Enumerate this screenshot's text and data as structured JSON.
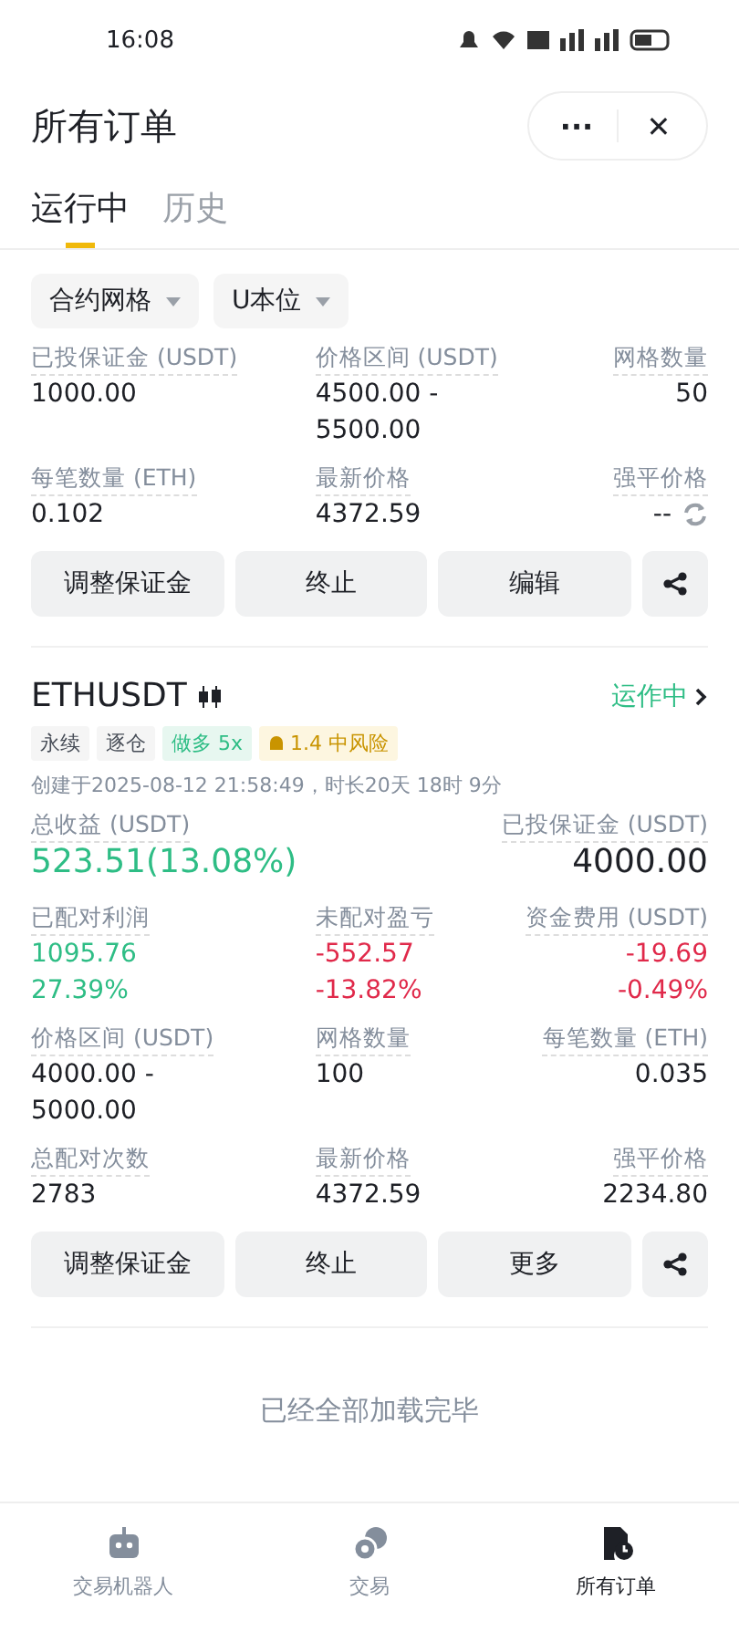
{
  "status_bar": {
    "time": "16:08"
  },
  "header": {
    "title": "所有订单",
    "more": "···",
    "close": "✕"
  },
  "tabs": [
    {
      "label": "运行中",
      "selected": true
    },
    {
      "label": "历史",
      "selected": false
    }
  ],
  "filters": [
    {
      "label": "合约网格"
    },
    {
      "label": "U本位"
    }
  ],
  "orders": [
    {
      "fields": [
        {
          "label": "已投保证金 (USDT)",
          "values": [
            {
              "text": "1000.00",
              "kind": "plain"
            }
          ]
        },
        {
          "label": "价格区间 (USDT)",
          "values": [
            {
              "text": "4500.00 -",
              "kind": "plain"
            },
            {
              "text": "5500.00",
              "kind": "plain"
            }
          ]
        },
        {
          "label": "网格数量",
          "values": [
            {
              "text": "50",
              "kind": "plain"
            }
          ]
        },
        {
          "label": "每笔数量 (ETH)",
          "values": [
            {
              "text": "0.102",
              "kind": "plain"
            }
          ]
        },
        {
          "label": "最新价格",
          "values": [
            {
              "text": "4372.59",
              "kind": "plain"
            }
          ]
        },
        {
          "label": "强平价格",
          "values": [
            {
              "text": "--",
              "kind": "plain",
              "refresh": true
            }
          ]
        }
      ],
      "actions": [
        "调整保证金",
        "终止",
        "编辑"
      ]
    },
    {
      "symbol": "ETHUSDT",
      "status": "运作中",
      "tags": [
        {
          "label": "永续",
          "kind": "plain"
        },
        {
          "label": "逐仓",
          "kind": "plain"
        },
        {
          "label": "做多 5x",
          "kind": "long"
        },
        {
          "label": "1.4 中风险",
          "kind": "risk"
        }
      ],
      "created": "创建于2025-08-12 21:58:49，时长20天 18时 9分",
      "summary": [
        {
          "label": "总收益 (USDT)",
          "value": "523.51(13.08%)",
          "kind": "green"
        },
        {
          "label": "已投保证金 (USDT)",
          "value": "4000.00",
          "kind": "plain"
        }
      ],
      "fields": [
        {
          "label": "已配对利润",
          "values": [
            {
              "text": "1095.76",
              "kind": "green"
            },
            {
              "text": "27.39%",
              "kind": "green"
            }
          ]
        },
        {
          "label": "未配对盈亏",
          "values": [
            {
              "text": "-552.57",
              "kind": "red"
            },
            {
              "text": "-13.82%",
              "kind": "red"
            }
          ]
        },
        {
          "label": "资金费用 (USDT)",
          "values": [
            {
              "text": "-19.69",
              "kind": "red"
            },
            {
              "text": "-0.49%",
              "kind": "red"
            }
          ]
        },
        {
          "label": "价格区间 (USDT)",
          "values": [
            {
              "text": "4000.00 -",
              "kind": "plain"
            },
            {
              "text": "5000.00",
              "kind": "plain"
            }
          ]
        },
        {
          "label": "网格数量",
          "values": [
            {
              "text": "100",
              "kind": "plain"
            }
          ]
        },
        {
          "label": "每笔数量 (ETH)",
          "values": [
            {
              "text": "0.035",
              "kind": "plain"
            }
          ]
        },
        {
          "label": "总配对次数",
          "values": [
            {
              "text": "2783",
              "kind": "plain"
            }
          ]
        },
        {
          "label": "最新价格",
          "values": [
            {
              "text": "4372.59",
              "kind": "plain"
            }
          ]
        },
        {
          "label": "强平价格",
          "values": [
            {
              "text": "2234.80",
              "kind": "plain"
            }
          ]
        }
      ],
      "actions": [
        "调整保证金",
        "终止",
        "更多"
      ]
    }
  ],
  "end_note": "已经全部加载完毕",
  "nav": [
    {
      "label": "交易机器人",
      "kind": "robot",
      "selected": false
    },
    {
      "label": "交易",
      "kind": "coins",
      "selected": false
    },
    {
      "label": "所有订单",
      "kind": "orders",
      "selected": true
    }
  ]
}
